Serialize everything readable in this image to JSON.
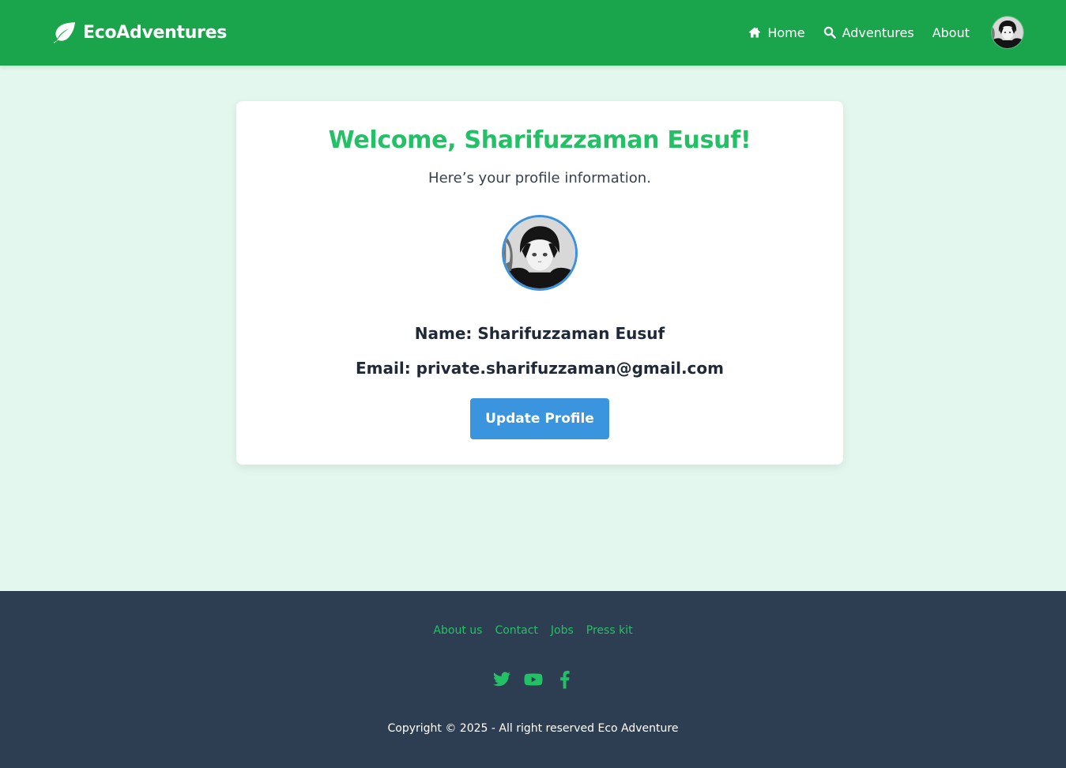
{
  "navbar": {
    "brand": "EcoAdventures",
    "brand_icon": "leaf-icon",
    "links": [
      {
        "label": "Home",
        "icon": "home-icon"
      },
      {
        "label": "Adventures",
        "icon": "search-icon"
      },
      {
        "label": "About",
        "icon": ""
      }
    ]
  },
  "profile": {
    "welcome": "Welcome, Sharifuzzaman Eusuf!",
    "subtitle": "Here’s your profile information.",
    "name_line": "Name: Sharifuzzaman Eusuf",
    "email_line": "Email: private.sharifuzzaman@gmail.com",
    "update_button": "Update Profile"
  },
  "footer": {
    "links": [
      "About us",
      "Contact",
      "Jobs",
      "Press kit"
    ],
    "social_icons": [
      "twitter-icon",
      "youtube-icon",
      "facebook-icon"
    ],
    "copyright": "Copyright © 2025 - All right reserved Eco Adventure"
  },
  "colors": {
    "nav_bg": "#1aa54d",
    "page_bg": "#e4f7ee",
    "accent_green": "#23c165",
    "button_blue": "#3a95de",
    "footer_bg": "#2e3e52"
  }
}
